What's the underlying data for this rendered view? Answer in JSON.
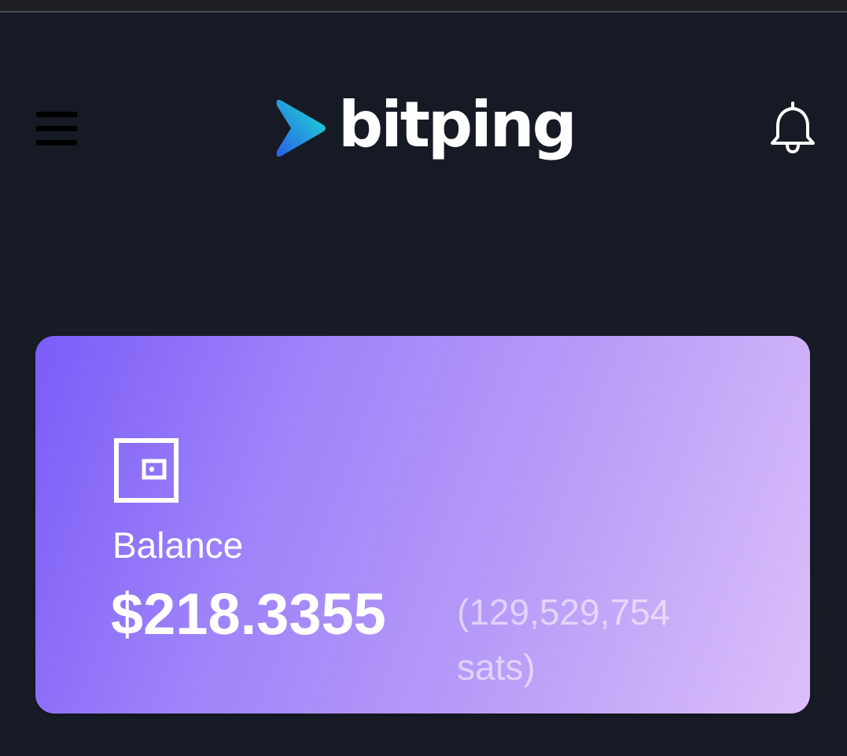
{
  "header": {
    "brand": "bitping"
  },
  "balance_card": {
    "label": "Balance",
    "amount": "$218.3355",
    "sats_line1": "(129,529,754",
    "sats_line2": "sats)"
  },
  "icons": {
    "menu": "hamburger-menu-icon",
    "logo": "bitping-arrow-logo",
    "notifications": "bell-icon",
    "wallet": "wallet-icon"
  },
  "colors": {
    "background": "#181c27",
    "header": "#161a24",
    "card_gradient_start": "#7b5cf8",
    "card_gradient_end": "#dcbff9",
    "logo_arrow_start": "#2a63e8",
    "logo_arrow_end": "#19e0d4"
  }
}
